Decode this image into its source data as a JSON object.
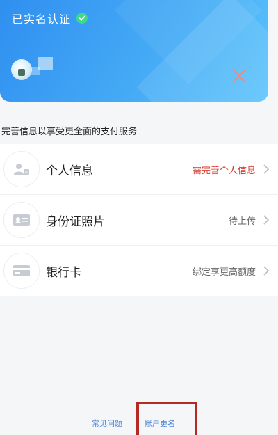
{
  "card": {
    "verified_label": "已实名认证",
    "colors": {
      "start": "#2f8ff0",
      "end": "#5cc4fb",
      "check": "#3ddc84",
      "close": "#f08a7e"
    },
    "icons": {
      "check": "check-circle-icon",
      "close": "close-icon",
      "avatar": "avatar"
    }
  },
  "hint": "完善信息以享受更全面的支付服务",
  "list": {
    "items": [
      {
        "label": "个人信息",
        "status": "需完善个人信息",
        "status_color": "#d63a2d",
        "icon": "person-card-icon"
      },
      {
        "label": "身份证照片",
        "status": "待上传",
        "status_color": "#666666",
        "icon": "id-card-icon"
      },
      {
        "label": "银行卡",
        "status": "绑定享更高额度",
        "status_color": "#666666",
        "icon": "bank-card-icon"
      }
    ]
  },
  "footer": {
    "faq_label": "常见问题",
    "rename_label": "账户更名",
    "highlight_color": "#b52a22"
  }
}
